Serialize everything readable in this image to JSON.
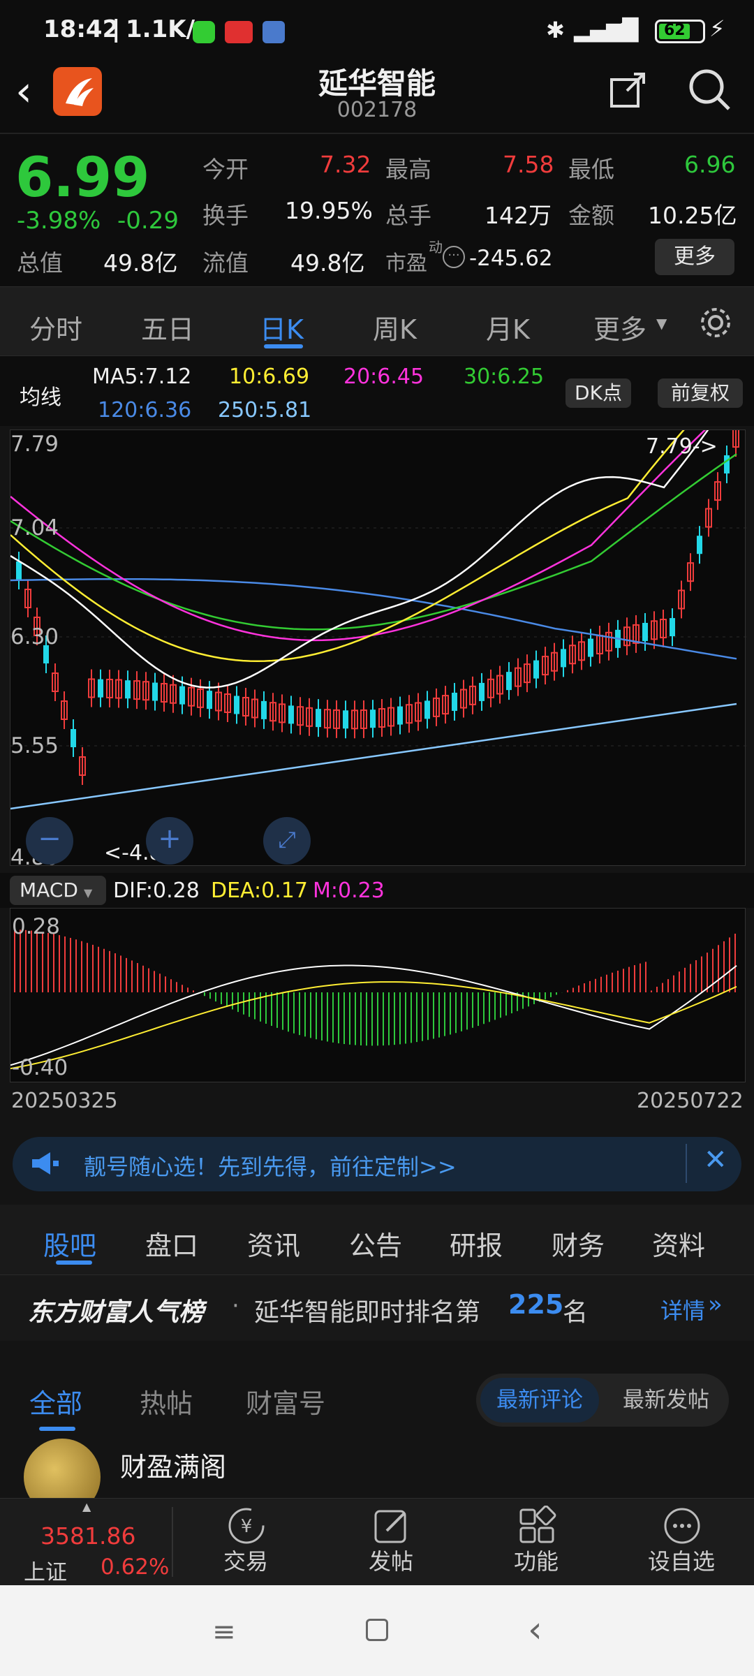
{
  "status": {
    "time": "18:42",
    "speed": "1.1K/s",
    "battery": "62"
  },
  "header": {
    "title": "延华智能",
    "code": "002178"
  },
  "quote": {
    "price": "6.99",
    "change_pct": "-3.98%",
    "change": "-0.29",
    "open_label": "今开",
    "open": "7.32",
    "high_label": "最高",
    "high": "7.58",
    "low_label": "最低",
    "low": "6.96",
    "turnover_label": "换手",
    "turnover": "19.95%",
    "volume_label": "总手",
    "volume": "142万",
    "amount_label": "金额",
    "amount": "10.25亿",
    "mktcap_label": "总值",
    "mktcap": "49.8亿",
    "float_label": "流值",
    "float": "49.8亿",
    "pe_label": "市盈",
    "pe_sup": "动",
    "pe": "-245.62",
    "more": "更多"
  },
  "tabs": [
    "分时",
    "五日",
    "日K",
    "周K",
    "月K",
    "更多"
  ],
  "ma": {
    "label": "均线",
    "ma5": "MA5:7.12",
    "ma10": "10:6.69",
    "ma20": "20:6.45",
    "ma30": "30:6.25",
    "ma120": "120:6.36",
    "ma250": "250:5.81",
    "dk": "DK点",
    "adjust": "前复权"
  },
  "kchart": {
    "y_labels": [
      "7.79",
      "7.04",
      "6.30",
      "5.55",
      "4.80"
    ],
    "max_label": "7.79->",
    "min_label": "<-4.80"
  },
  "macd": {
    "selector": "MACD",
    "dif": "DIF:0.28",
    "dea": "DEA:0.17",
    "m": "M:0.23",
    "top": "0.28",
    "bottom": "-0.40"
  },
  "dates": {
    "start": "20250325",
    "end": "20250722"
  },
  "banner": {
    "text": "靓号随心选！先到先得，前往定制>>"
  },
  "subtabs": [
    "股吧",
    "盘口",
    "资讯",
    "公告",
    "研报",
    "财务",
    "资料"
  ],
  "rank": {
    "brand": "东方财富人气榜",
    "text": "延华智能即时排名第",
    "num": "225",
    "unit": "名",
    "detail": "详情"
  },
  "feedtabs": {
    "tabs": [
      "全部",
      "热帖",
      "财富号"
    ],
    "sort": [
      "最新评论",
      "最新发帖"
    ]
  },
  "post": {
    "author": "财盈满阁"
  },
  "bottombar": {
    "index_value": "3581.86",
    "index_name": "上证",
    "index_change": "0.62%",
    "items": [
      "交易",
      "发帖",
      "功能",
      "设自选"
    ]
  },
  "colors": {
    "up": "#f03c3c",
    "down": "#2ec83c",
    "accent": "#3c8cf0",
    "ma5": "#ffffff",
    "ma10": "#ffee33",
    "ma20": "#ff33dd",
    "ma30": "#33cc33",
    "ma120": "#4a8ae6",
    "ma250": "#88c8ff"
  }
}
